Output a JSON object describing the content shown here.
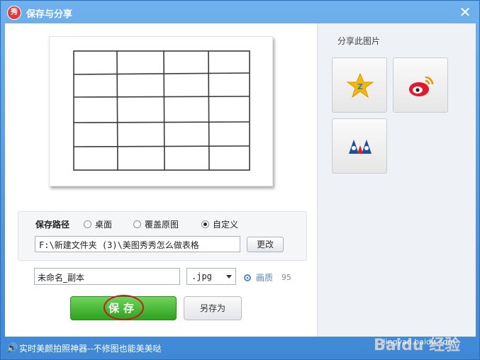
{
  "window": {
    "title": "保存与分享",
    "app_logo_text": "秀"
  },
  "share": {
    "label": "分享此图片",
    "buttons": [
      {
        "icon": "qzone-star-icon"
      },
      {
        "icon": "weibo-icon"
      },
      {
        "icon": "renren-icon"
      }
    ]
  },
  "save_path": {
    "label": "保存路径",
    "options": [
      {
        "label": "桌面",
        "selected": false
      },
      {
        "label": "覆盖原图",
        "selected": false
      },
      {
        "label": "自定义",
        "selected": true
      }
    ],
    "path_value": "F:\\新建文件夹 (3)\\美图秀秀怎么做表格",
    "change_label": "更改"
  },
  "file": {
    "name_value": "未命名_副本",
    "format_value": ".jpg",
    "quality_label": "画质",
    "quality_value": "95"
  },
  "actions": {
    "save_label": "保存",
    "save_as_label": "另存为"
  },
  "status": {
    "text": "实时美颜拍照神器--不修图也能美美哒",
    "watermark": "jingyan.baidu.com",
    "watermark_logo": "Baidu 经验"
  },
  "colors": {
    "titlebar": "#4a8fd6",
    "save_green": "#2ea21e",
    "highlight_ring": "#c8191e"
  }
}
